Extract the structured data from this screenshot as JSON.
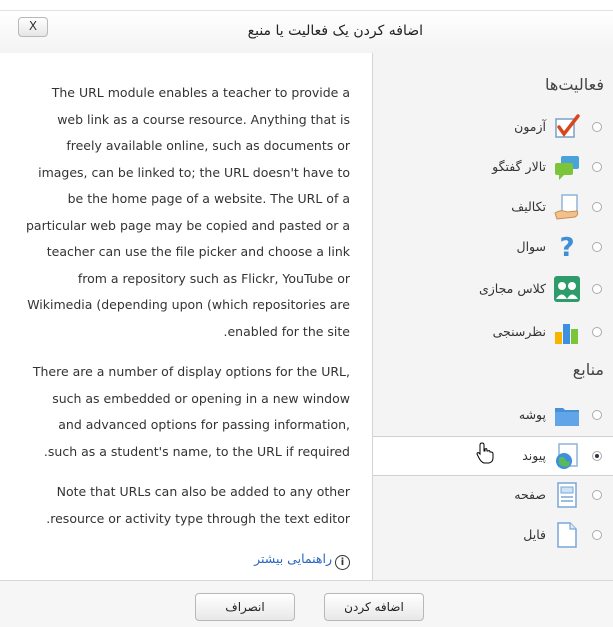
{
  "dialog": {
    "title": "اضافه کردن یک فعالیت یا منبع",
    "close_label": "X"
  },
  "description": {
    "paragraphs": [
      "The URL module enables a teacher to provide a web link as a course resource. Anything that is freely available online, such as documents or images, can be linked to; the URL doesn't have to be the home page of a website. The URL of a particular web page may be copied and pasted or a teacher can use the file picker and choose a link from a repository such as Flickr, YouTube or Wikimedia (depending upon (which repositories are enabled for the site.",
      "There are a number of display options for the URL, such as embedded or opening in a new window and advanced options for passing information, such as a student's name, to the URL if required.",
      "Note that URLs can also be added to any other resource or activity type through the text editor."
    ],
    "more_help": "راهنمایی بیشتر"
  },
  "activities": {
    "heading": "فعالیت‌ها",
    "items": [
      {
        "label": "آزمون",
        "icon": "quiz-check-icon"
      },
      {
        "label": "تالار گفتگو",
        "icon": "forum-bubbles-icon"
      },
      {
        "label": "تکالیف",
        "icon": "assignment-hand-icon"
      },
      {
        "label": "سوال",
        "icon": "question-mark-icon"
      },
      {
        "label": "کلاس مجازی",
        "icon": "virtual-class-icon"
      },
      {
        "label": "نظرسنجی",
        "icon": "bar-chart-icon"
      }
    ]
  },
  "resources": {
    "heading": "منابع",
    "items": [
      {
        "label": "پوشه",
        "icon": "folder-icon",
        "selected": false
      },
      {
        "label": "پیوند",
        "icon": "url-globe-icon",
        "selected": true
      },
      {
        "label": "صفحه",
        "icon": "page-icon",
        "selected": false
      },
      {
        "label": "فایل",
        "icon": "file-icon",
        "selected": false
      }
    ]
  },
  "footer": {
    "add_label": "اضافه کردن",
    "cancel_label": "انصراف"
  },
  "colors": {
    "accent_link": "#2a66c0",
    "panel_bg": "#f4f4f4"
  }
}
